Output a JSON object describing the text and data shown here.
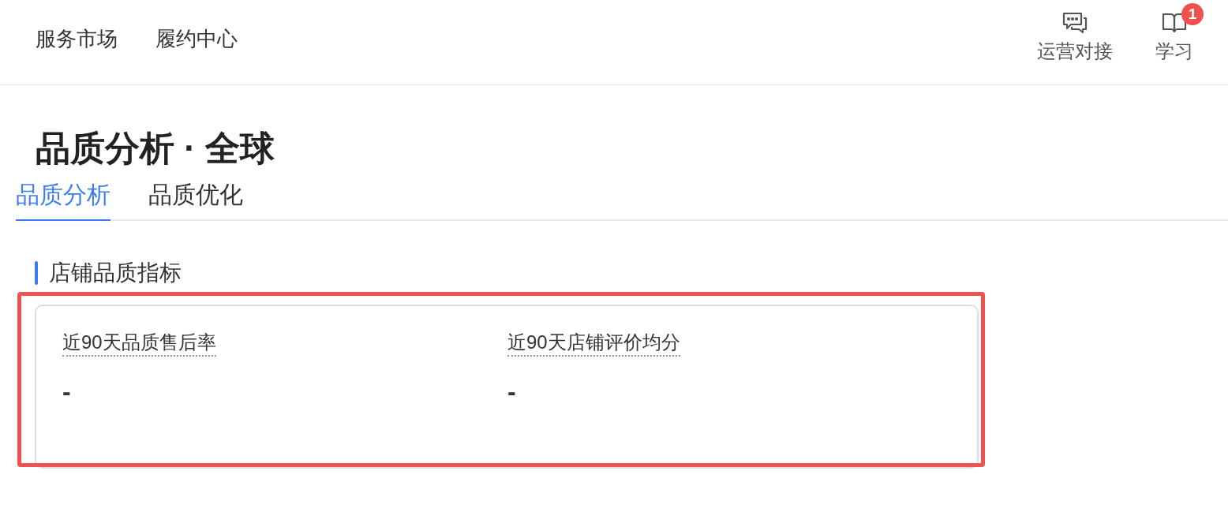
{
  "top_nav": {
    "links": [
      {
        "label": "服务市场"
      },
      {
        "label": "履约中心"
      }
    ],
    "actions": [
      {
        "kind": "chat",
        "label": "运营对接"
      },
      {
        "kind": "book",
        "label": "学习",
        "badge": "1"
      }
    ]
  },
  "page_title": "品质分析 · 全球",
  "tabs": [
    {
      "label": "品质分析",
      "selected": true
    },
    {
      "label": "品质优化",
      "selected": false
    }
  ],
  "section": {
    "title": "店铺品质指标",
    "highlighted": true,
    "metrics": [
      {
        "label": "近90天品质售后率",
        "value": "-"
      },
      {
        "label": "近90天店铺评价均分",
        "value": "-"
      }
    ]
  }
}
